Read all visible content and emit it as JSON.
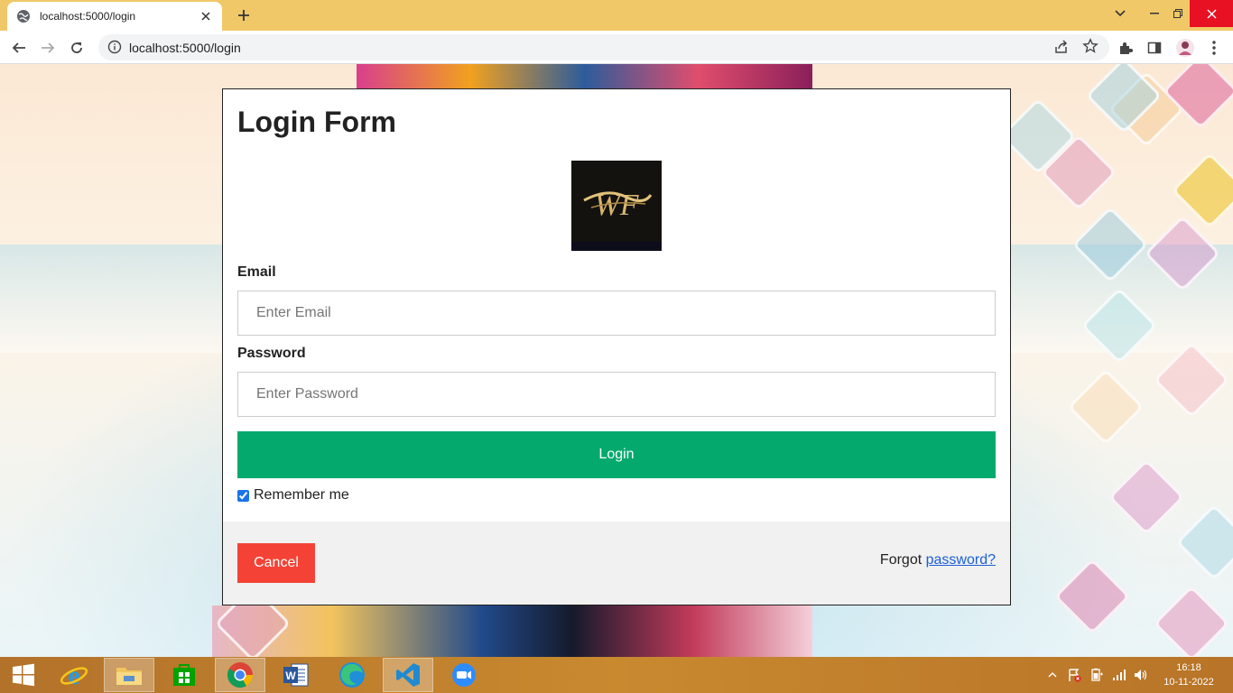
{
  "browser": {
    "tab_title": "localhost:5000/login",
    "url": "localhost:5000/login"
  },
  "form": {
    "title": "Login Form",
    "email_label": "Email",
    "email_placeholder": "Enter Email",
    "email_value": "",
    "password_label": "Password",
    "password_placeholder": "Enter Password",
    "password_value": "",
    "login_label": "Login",
    "remember_label": "Remember me",
    "remember_checked": true,
    "cancel_label": "Cancel",
    "forgot_text": "Forgot",
    "forgot_link": "password?"
  },
  "taskbar": {
    "apps": [
      "start-icon",
      "internet-explorer-icon",
      "file-explorer-icon",
      "store-icon",
      "chrome-icon",
      "word-icon",
      "edge-icon",
      "vscode-icon",
      "zoom-icon"
    ],
    "active_app": "chrome-icon",
    "time": "16:18",
    "date": "10-11-2022"
  },
  "colors": {
    "login_button": "#04aa6d",
    "cancel_button": "#f44336",
    "link": "#1a5fd8",
    "tabstrip": "#f0c868"
  }
}
